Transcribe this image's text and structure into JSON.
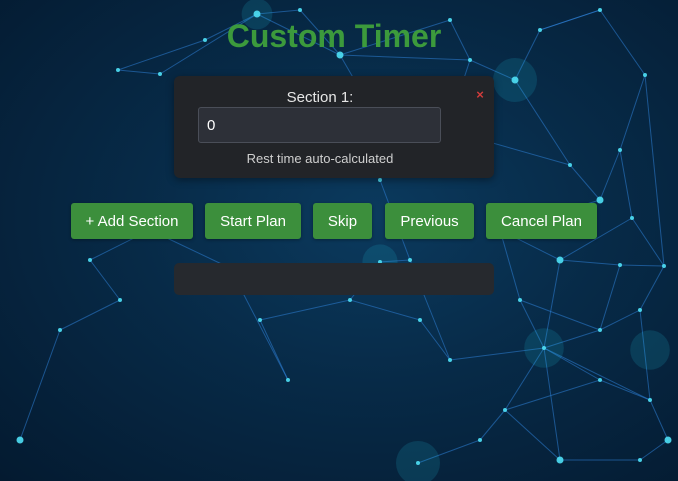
{
  "page": {
    "title": "Custom Timer"
  },
  "section": {
    "label": "Section 1:",
    "remove_symbol": "×",
    "input_value": "0",
    "rest_note": "Rest time auto-calculated"
  },
  "buttons": {
    "add_section": "+ Add Section",
    "start_plan": "Start Plan",
    "skip": "Skip",
    "previous": "Previous",
    "cancel_plan": "Cancel Plan"
  },
  "status": {
    "text": ""
  },
  "colors": {
    "title_green": "#3c9a3c",
    "button_green": "#3c8f3c",
    "remove_red": "#d23c3c",
    "card_dark": "#222428"
  }
}
